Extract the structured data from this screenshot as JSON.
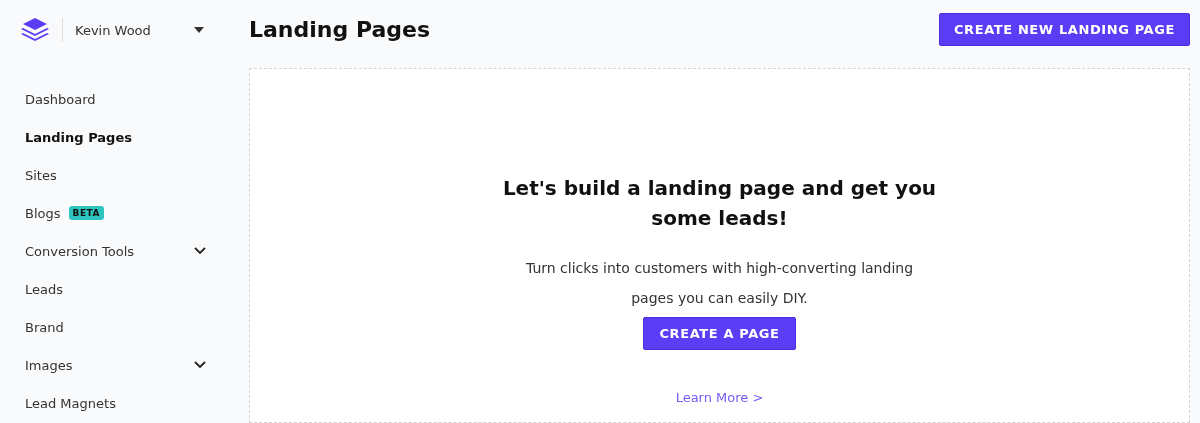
{
  "account": {
    "name": "Kevin Wood"
  },
  "sidebar": {
    "items": [
      {
        "label": "Dashboard",
        "selected": false,
        "expandable": false
      },
      {
        "label": "Landing Pages",
        "selected": true,
        "expandable": false
      },
      {
        "label": "Sites",
        "selected": false,
        "expandable": false
      },
      {
        "label": "Blogs",
        "selected": false,
        "expandable": false,
        "badge": "BETA"
      },
      {
        "label": "Conversion Tools",
        "selected": false,
        "expandable": true
      },
      {
        "label": "Leads",
        "selected": false,
        "expandable": false
      },
      {
        "label": "Brand",
        "selected": false,
        "expandable": false
      },
      {
        "label": "Images",
        "selected": false,
        "expandable": true
      },
      {
        "label": "Lead Magnets",
        "selected": false,
        "expandable": false
      }
    ]
  },
  "header": {
    "title": "Landing Pages",
    "button": "CREATE NEW LANDING PAGE"
  },
  "empty_state": {
    "heading": "Let's build a landing page and get you some leads!",
    "text": "Turn clicks into customers with high-converting landing pages you can easily DIY.",
    "button": "CREATE A PAGE",
    "link": "Learn More >"
  }
}
